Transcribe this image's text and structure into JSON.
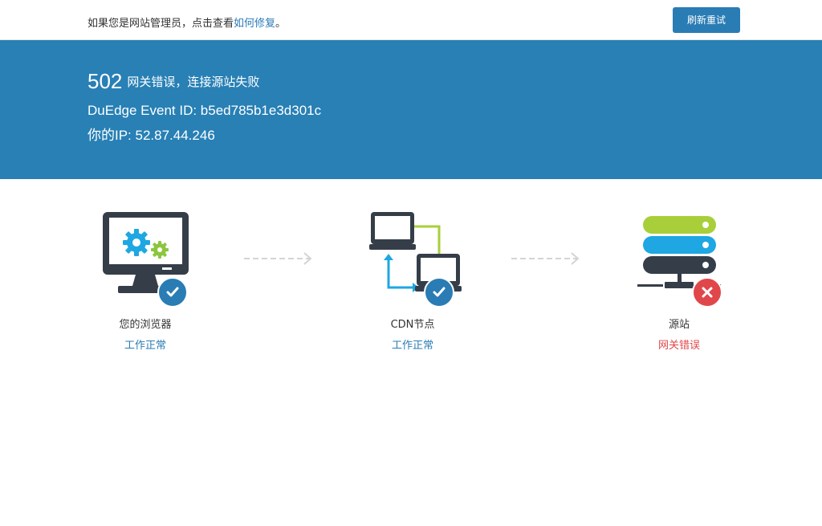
{
  "topbar": {
    "notice_prefix": "如果您是网站管理员，点击查看",
    "notice_link": "如何修复",
    "notice_suffix": "。",
    "retry_label": "刷新重试"
  },
  "banner": {
    "code": "502",
    "message": "网关错误，连接源站失败",
    "event_line": "DuEdge Event ID: b5ed785b1e3d301c",
    "ip_line": "你的IP: 52.87.44.246"
  },
  "nodes": [
    {
      "name": "您的浏览器",
      "status": "工作正常",
      "icon": "browser-monitor-icon",
      "badge": "check-icon"
    },
    {
      "name": "CDN节点",
      "status": "工作正常",
      "icon": "cdn-network-icon",
      "badge": "check-icon"
    },
    {
      "name": "源站",
      "status": "网关错误",
      "icon": "server-stack-icon",
      "badge": "error-x-icon"
    }
  ],
  "colors": {
    "brand_blue": "#2880b5",
    "ok_text": "#2a7cb4",
    "error_text": "#e0474b",
    "device_dark": "#353e48",
    "gear_blue": "#1ea7e2",
    "gear_green": "#8cc63f",
    "server_green": "#a8cf3a"
  }
}
